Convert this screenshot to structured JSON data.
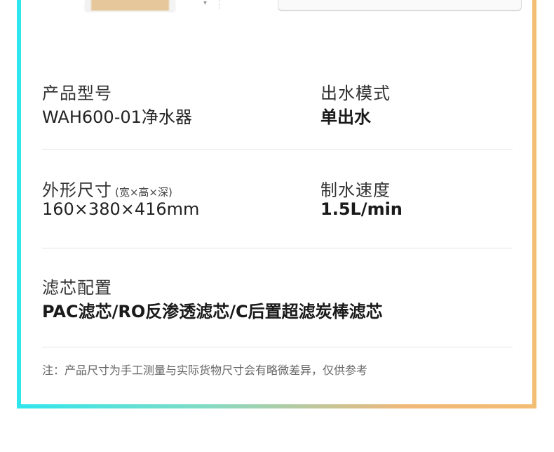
{
  "specs": {
    "model": {
      "label": "产品型号",
      "value": "WAH600-01净水器"
    },
    "mode": {
      "label": "出水模式",
      "value": "单出水"
    },
    "size": {
      "label": "外形尺寸",
      "sub": "(宽×高×深)",
      "value": "160×380×416mm"
    },
    "speed": {
      "label": "制水速度",
      "value": "1.5L/min"
    },
    "filter": {
      "label": "滤芯配置",
      "value": "PAC滤芯/RO反渗透滤芯/C后置超滤炭棒滤芯"
    }
  },
  "note": "注：产品尺寸为手工测量与实际货物尺寸会有略微差异，仅供参考",
  "colors": {
    "frame_left": "#2ee6ee",
    "frame_right": "#f1b779"
  }
}
